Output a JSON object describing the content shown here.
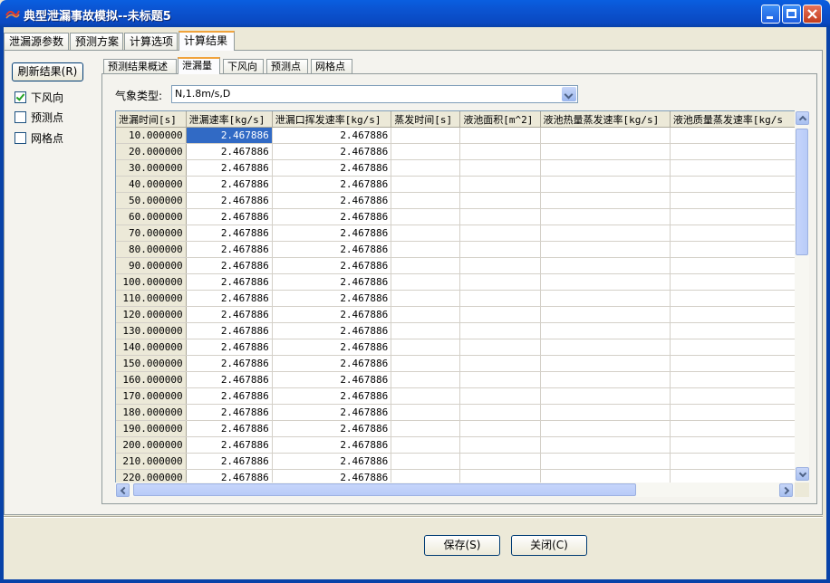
{
  "window": {
    "title": "典型泄漏事故模拟--未标题5"
  },
  "top_tabs": [
    "泄漏源参数",
    "预测方案",
    "计算选项",
    "计算结果"
  ],
  "refresh_button": "刷新结果(R)",
  "checkboxes": [
    {
      "label": "下风向",
      "checked": true
    },
    {
      "label": "预测点",
      "checked": false
    },
    {
      "label": "网格点",
      "checked": false
    }
  ],
  "inner_tabs": [
    "预测结果概述",
    "泄漏量",
    "下风向",
    "预测点",
    "网格点"
  ],
  "weather": {
    "label": "气象类型:",
    "value": "N,1.8m/s,D"
  },
  "table": {
    "headers": [
      "泄漏时间[s]",
      "泄漏速率[kg/s]",
      "泄漏口挥发速率[kg/s]",
      "蒸发时间[s]",
      "液池面积[m^2]",
      "液池热量蒸发速率[kg/s]",
      "液池质量蒸发速率[kg/s"
    ],
    "rows": [
      [
        "10.000000",
        "2.467886",
        "2.467886"
      ],
      [
        "20.000000",
        "2.467886",
        "2.467886"
      ],
      [
        "30.000000",
        "2.467886",
        "2.467886"
      ],
      [
        "40.000000",
        "2.467886",
        "2.467886"
      ],
      [
        "50.000000",
        "2.467886",
        "2.467886"
      ],
      [
        "60.000000",
        "2.467886",
        "2.467886"
      ],
      [
        "70.000000",
        "2.467886",
        "2.467886"
      ],
      [
        "80.000000",
        "2.467886",
        "2.467886"
      ],
      [
        "90.000000",
        "2.467886",
        "2.467886"
      ],
      [
        "100.000000",
        "2.467886",
        "2.467886"
      ],
      [
        "110.000000",
        "2.467886",
        "2.467886"
      ],
      [
        "120.000000",
        "2.467886",
        "2.467886"
      ],
      [
        "130.000000",
        "2.467886",
        "2.467886"
      ],
      [
        "140.000000",
        "2.467886",
        "2.467886"
      ],
      [
        "150.000000",
        "2.467886",
        "2.467886"
      ],
      [
        "160.000000",
        "2.467886",
        "2.467886"
      ],
      [
        "170.000000",
        "2.467886",
        "2.467886"
      ],
      [
        "180.000000",
        "2.467886",
        "2.467886"
      ],
      [
        "190.000000",
        "2.467886",
        "2.467886"
      ],
      [
        "200.000000",
        "2.467886",
        "2.467886"
      ],
      [
        "210.000000",
        "2.467886",
        "2.467886"
      ],
      [
        "220.000000",
        "2.467886",
        "2.467886"
      ]
    ]
  },
  "buttons": {
    "save": "保存(S)",
    "close": "关闭(C)"
  }
}
